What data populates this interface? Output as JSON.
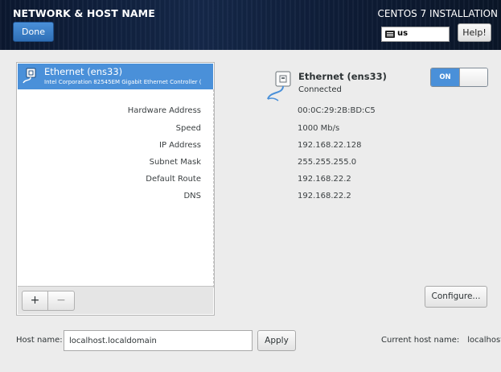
{
  "header": {
    "title": "NETWORK & HOST NAME",
    "done_label": "Done",
    "product": "CENTOS 7 INSTALLATION",
    "keyboard_layout": "us",
    "help_label": "Help!"
  },
  "device_list": {
    "items": [
      {
        "name": "Ethernet (ens33)",
        "description": "Intel Corporation 82545EM Gigabit Ethernet Controller ("
      }
    ],
    "add_label": "+",
    "remove_label": "−"
  },
  "device": {
    "name": "Ethernet (ens33)",
    "status": "Connected",
    "toggle_label": "ON",
    "properties": [
      {
        "label": "Hardware Address",
        "value": "00:0C:29:2B:BD:C5"
      },
      {
        "label": "Speed",
        "value": "1000 Mb/s"
      },
      {
        "label": "IP Address",
        "value": "192.168.22.128"
      },
      {
        "label": "Subnet Mask",
        "value": "255.255.255.0"
      },
      {
        "label": "Default Route",
        "value": "192.168.22.2"
      },
      {
        "label": "DNS",
        "value": "192.168.22.2"
      }
    ],
    "configure_label": "Configure..."
  },
  "hostname": {
    "label": "Host name:",
    "value": "localhost.localdomain",
    "apply_label": "Apply",
    "current_label": "Current host name:",
    "current_value": "localhost"
  },
  "colors": {
    "accent": "#4a90d9",
    "header_bg": "#15284a"
  }
}
